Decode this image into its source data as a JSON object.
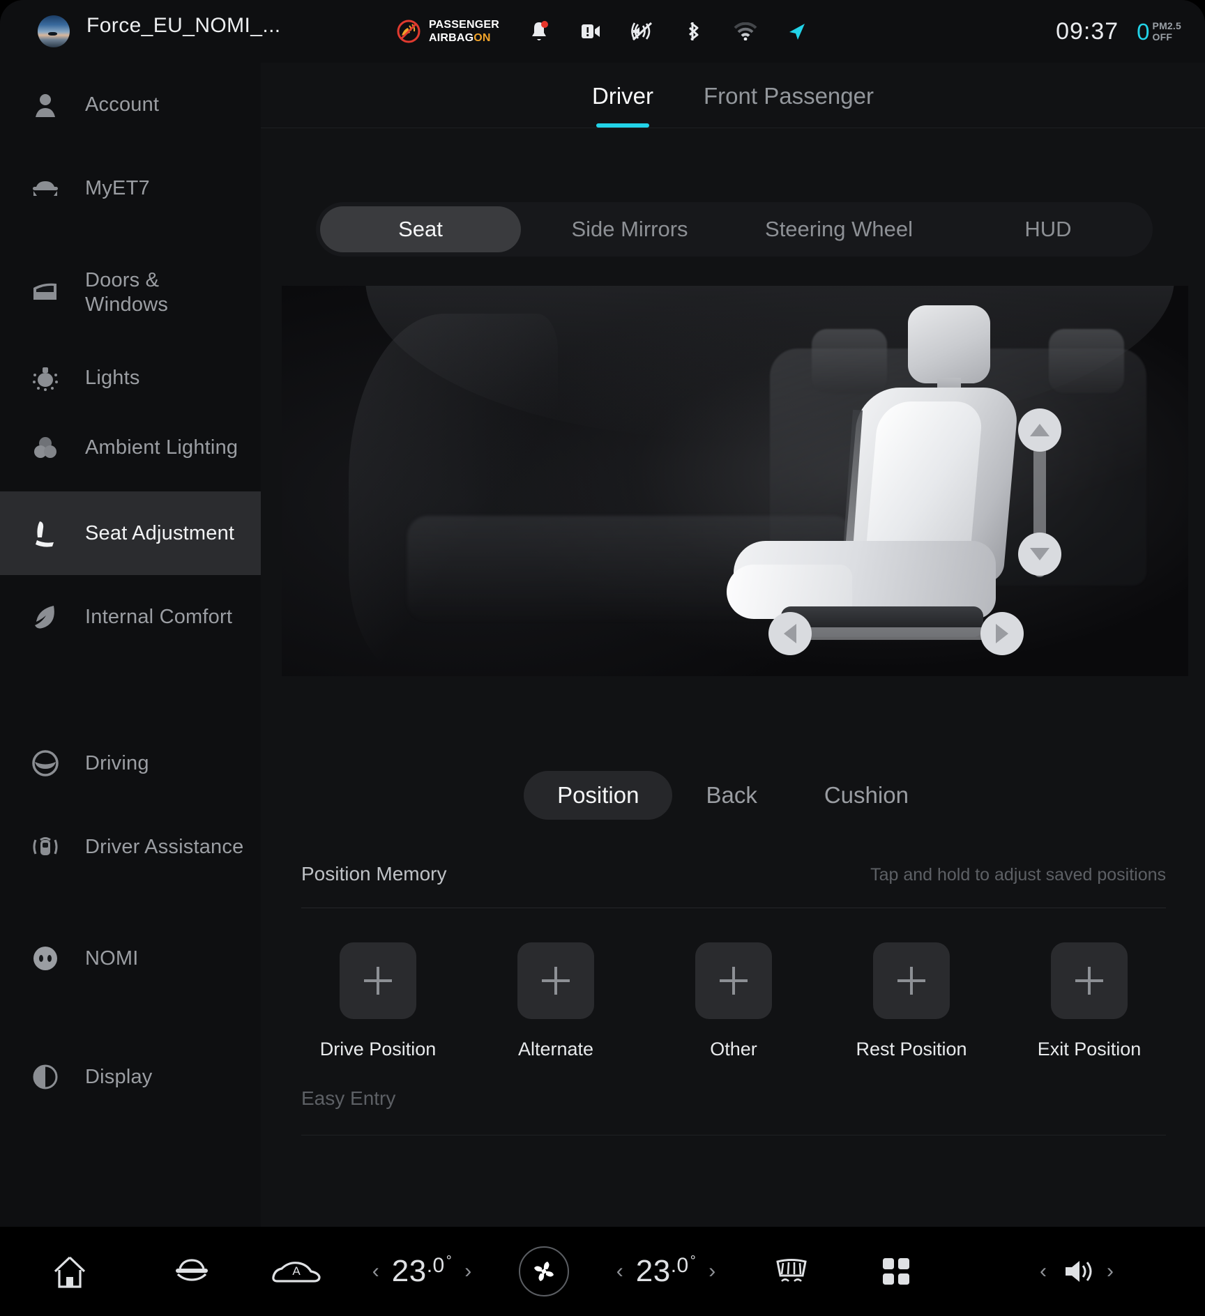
{
  "window": {
    "title": "Force_EU_NOMI_...",
    "avatar_icon": "user-photo-avatar"
  },
  "statusbar": {
    "airbag": {
      "line1": "PASSENGER",
      "line2": "AIRBAG",
      "state": "ON",
      "state_color": "#f0a32a",
      "icon": "passenger-airbag-off-icon"
    },
    "icons": [
      "notification-bell-icon",
      "dashcam-warning-icon",
      "sound-muted-icon",
      "bluetooth-icon",
      "wifi-icon",
      "navigation-arrow-icon"
    ],
    "time": "09:37",
    "pm25": {
      "value": "0",
      "label_line1": "PM2.5",
      "label_line2": "OFF",
      "value_color": "#22d3e8"
    }
  },
  "sidebar": {
    "items": [
      {
        "label": "Account",
        "icon": "account-person-icon",
        "active": false
      },
      {
        "label": "MyET7",
        "icon": "car-front-icon",
        "active": false
      },
      {
        "label": "Doors &\nWindows",
        "icon": "car-door-window-icon",
        "active": false
      },
      {
        "label": "Lights",
        "icon": "headlight-icon",
        "active": false
      },
      {
        "label": "Ambient Lighting",
        "icon": "ambient-lighting-circles-icon",
        "active": false
      },
      {
        "label": "Seat Adjustment",
        "icon": "seat-icon",
        "active": true
      },
      {
        "label": "Internal Comfort",
        "icon": "leaf-icon",
        "active": false
      },
      {
        "label": "Driving",
        "icon": "steering-wheel-icon",
        "active": false
      },
      {
        "label": "Driver Assistance",
        "icon": "driver-assistance-icon",
        "active": false
      },
      {
        "label": "NOMI",
        "icon": "nomi-face-icon",
        "active": false
      },
      {
        "label": "Display",
        "icon": "display-contrast-icon",
        "active": false
      }
    ]
  },
  "main": {
    "occupant_tabs": [
      {
        "label": "Driver",
        "active": true
      },
      {
        "label": "Front Passenger",
        "active": false
      }
    ],
    "accent_color": "#22d3e8",
    "category_tabs": [
      {
        "label": "Seat",
        "active": true
      },
      {
        "label": "Side Mirrors",
        "active": false
      },
      {
        "label": "Steering Wheel",
        "active": false
      },
      {
        "label": "HUD",
        "active": false
      }
    ],
    "seat_controls": {
      "up_icon": "arrow-up-icon",
      "down_icon": "arrow-down-icon",
      "left_icon": "arrow-left-icon",
      "right_icon": "arrow-right-icon"
    },
    "adjust_tabs": [
      {
        "label": "Position",
        "active": true
      },
      {
        "label": "Back",
        "active": false
      },
      {
        "label": "Cushion",
        "active": false
      }
    ],
    "position_memory": {
      "title": "Position Memory",
      "hint": "Tap and hold to adjust saved positions",
      "presets": [
        {
          "label": "Drive Position",
          "icon": "plus-icon"
        },
        {
          "label": "Alternate",
          "icon": "plus-icon"
        },
        {
          "label": "Other",
          "icon": "plus-icon"
        },
        {
          "label": "Rest Position",
          "icon": "plus-icon"
        },
        {
          "label": "Exit Position",
          "icon": "plus-icon"
        }
      ]
    },
    "easy_entry": {
      "title": "Easy Entry"
    }
  },
  "dock": {
    "home_icon": "home-icon",
    "car_icon": "car-front-icon",
    "auto_car_icon": "car-auto-profile-icon",
    "left_temp": {
      "value": "23",
      "decimal": ".0",
      "degree": "°",
      "prev_icon": "chevron-left-icon",
      "next_icon": "chevron-right-icon"
    },
    "fan_icon": "fan-icon",
    "right_temp": {
      "value": "23",
      "decimal": ".0",
      "degree": "°",
      "prev_icon": "chevron-left-icon",
      "next_icon": "chevron-right-icon"
    },
    "defrost_icon": "rear-defrost-icon",
    "apps_icon": "apps-grid-icon",
    "volume": {
      "icon": "volume-icon",
      "prev_icon": "chevron-left-icon",
      "next_icon": "chevron-right-icon"
    }
  }
}
